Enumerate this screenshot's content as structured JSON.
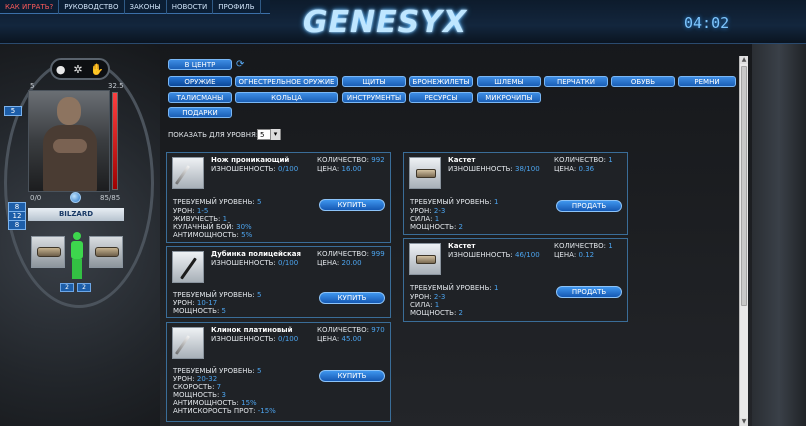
{
  "topnav": {
    "items": [
      "КАК ИГРАТЬ?",
      "РУКОВОДСТВО",
      "ЗАКОНЫ",
      "НОВОСТИ",
      "ПРОФИЛЬ"
    ]
  },
  "logo": "GENESYX",
  "clock": "04:02",
  "character": {
    "left_num": "5",
    "hp_num": "32.5",
    "side_tab": "5",
    "bottom_left": "0/0",
    "bottom_right": "85/85",
    "name": "BILZARD",
    "side_stats": [
      "8",
      "12",
      "8"
    ],
    "slot_counts": [
      "2",
      "2"
    ],
    "hp_fraction": 1.0
  },
  "center_button": "В ЦЕНТР",
  "categories_row1": [
    "ОРУЖИЕ",
    "ОГНЕСТРЕЛЬНОЕ ОРУЖИЕ",
    "ЩИТЫ",
    "БРОНЕЖИЛЕТЫ",
    "ШЛЕМЫ",
    "ПЕРЧАТКИ",
    "ОБУВЬ",
    "РЕМНИ"
  ],
  "categories_row2": [
    "ТАЛИСМАНЫ",
    "КОЛЬЦА",
    "ИНСТРУМЕНТЫ",
    "РЕСУРСЫ",
    "МИКРОЧИПЫ"
  ],
  "categories_row3": [
    "ПОДАРКИ"
  ],
  "level_filter": {
    "label": "ПОКАЗАТЬ ДЛЯ УРОВНЯ:",
    "value": "5"
  },
  "shop_items": [
    {
      "name": "Нож проникающий",
      "durability_label": "ИЗНОШЕННОСТЬ:",
      "durability": "0/100",
      "qty_label": "КОЛИЧЕСТВО:",
      "qty": "992",
      "price_label": "ЦЕНА:",
      "price": "16.00",
      "stats": [
        {
          "label": "ТРЕБУЕМЫЙ УРОВЕНЬ:",
          "value": "5"
        },
        {
          "label": "УРОН:",
          "value": "1-5"
        },
        {
          "label": "ЖИВУЧЕСТЬ:",
          "value": "1"
        },
        {
          "label": "КУЛАЧНЫЙ БОЙ:",
          "value": "30%"
        },
        {
          "label": "АНТИМОЩНОСТЬ:",
          "value": "5%"
        }
      ],
      "action": "КУПИТЬ"
    },
    {
      "name": "Дубинка полицейская",
      "durability_label": "ИЗНОШЕННОСТЬ:",
      "durability": "0/100",
      "qty_label": "КОЛИЧЕСТВО:",
      "qty": "999",
      "price_label": "ЦЕНА:",
      "price": "20.00",
      "stats": [
        {
          "label": "ТРЕБУЕМЫЙ УРОВЕНЬ:",
          "value": "5"
        },
        {
          "label": "УРОН:",
          "value": "10-17"
        },
        {
          "label": "МОЩНОСТЬ:",
          "value": "5"
        }
      ],
      "action": "КУПИТЬ"
    },
    {
      "name": "Клинок платиновый",
      "durability_label": "ИЗНОШЕННОСТЬ:",
      "durability": "0/100",
      "qty_label": "КОЛИЧЕСТВО:",
      "qty": "970",
      "price_label": "ЦЕНА:",
      "price": "45.00",
      "stats": [
        {
          "label": "ТРЕБУЕМЫЙ УРОВЕНЬ:",
          "value": "5"
        },
        {
          "label": "УРОН:",
          "value": "20-32"
        },
        {
          "label": "СКОРОСТЬ:",
          "value": "7"
        },
        {
          "label": "МОЩНОСТЬ:",
          "value": "3"
        },
        {
          "label": "АНТИМОЩНОСТЬ:",
          "value": "15%"
        },
        {
          "label": "АНТИСКОРОСТЬ ПРОТ:",
          "value": "-15%"
        }
      ],
      "action": "КУПИТЬ"
    }
  ],
  "inventory_items": [
    {
      "name": "Кастет",
      "durability_label": "ИЗНОШЕННОСТЬ:",
      "durability": "38/100",
      "qty_label": "КОЛИЧЕСТВО:",
      "qty": "1",
      "price_label": "ЦЕНА:",
      "price": "0.36",
      "stats": [
        {
          "label": "ТРЕБУЕМЫЙ УРОВЕНЬ:",
          "value": "1"
        },
        {
          "label": "УРОН:",
          "value": "2-3"
        },
        {
          "label": "СИЛА:",
          "value": "1"
        },
        {
          "label": "МОЩНОСТЬ:",
          "value": "2"
        }
      ],
      "action": "ПРОДАТЬ"
    },
    {
      "name": "Кастет",
      "durability_label": "ИЗНОШЕННОСТЬ:",
      "durability": "46/100",
      "qty_label": "КОЛИЧЕСТВО:",
      "qty": "1",
      "price_label": "ЦЕНА:",
      "price": "0.12",
      "stats": [
        {
          "label": "ТРЕБУЕМЫЙ УРОВЕНЬ:",
          "value": "1"
        },
        {
          "label": "УРОН:",
          "value": "2-3"
        },
        {
          "label": "СИЛА:",
          "value": "1"
        },
        {
          "label": "МОЩНОСТЬ:",
          "value": "2"
        }
      ],
      "action": "ПРОДАТЬ"
    }
  ]
}
